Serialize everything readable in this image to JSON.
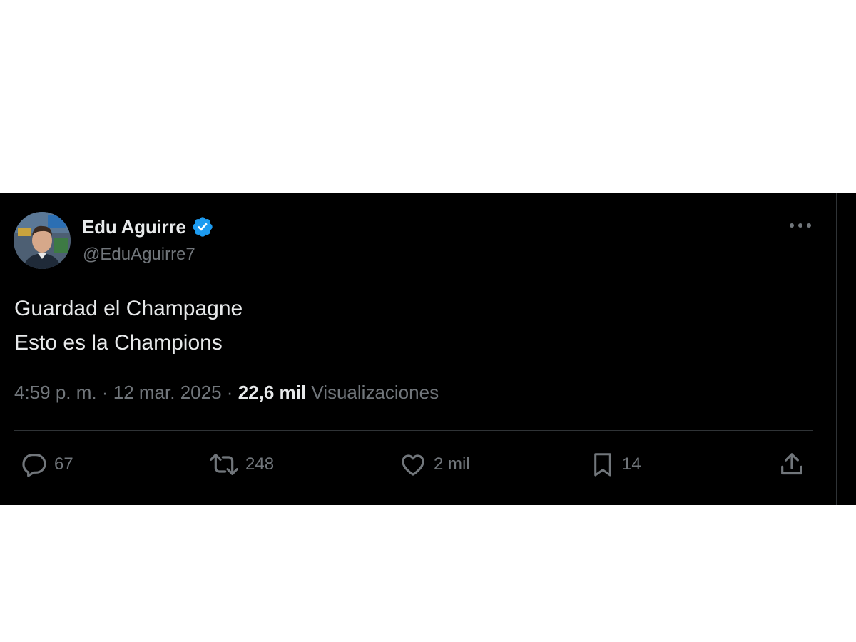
{
  "user": {
    "display_name": "Edu Aguirre",
    "handle": "@EduAguirre7",
    "verified": true,
    "avatar_icon": "profile-photo"
  },
  "tweet": {
    "lines": [
      "Guardad el Champagne",
      "Esto es la Champions"
    ],
    "time": "4:59 p. m.",
    "separator": "·",
    "date": "12 mar. 2025",
    "views_count": "22,6 mil",
    "views_label": "Visualizaciones"
  },
  "actions": {
    "replies": "67",
    "retweets": "248",
    "likes": "2 mil",
    "bookmarks": "14"
  },
  "icons": {
    "more": "more-horizontal-icon",
    "reply": "reply-bubble-icon",
    "retweet": "retweet-icon",
    "like": "heart-icon",
    "bookmark": "bookmark-icon",
    "share": "share-upload-icon"
  },
  "colors": {
    "background": "#000000",
    "primary_text": "#e7e9ea",
    "secondary_text": "#71767b",
    "verified_badge": "#1d9bf0",
    "divider": "#2f3336"
  }
}
